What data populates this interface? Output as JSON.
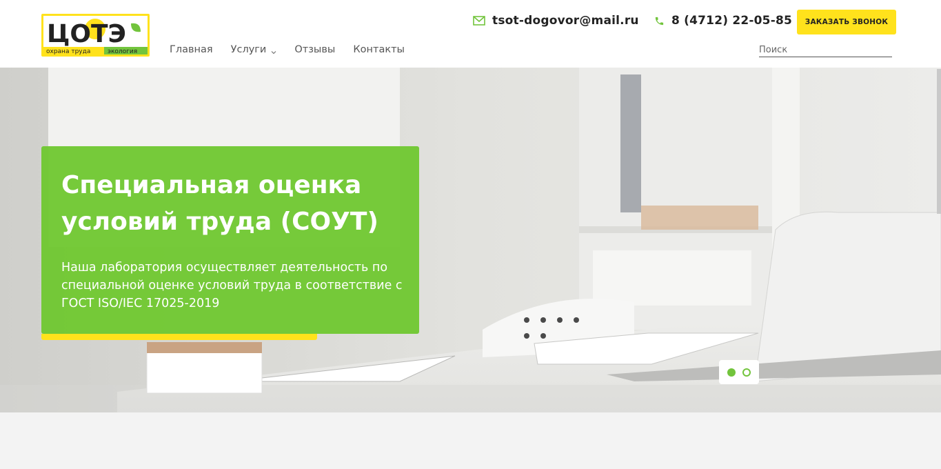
{
  "brand": {
    "logo_main": "ЦОТЭ",
    "logo_tag_left": "охрана труда",
    "logo_tag_right": "экология",
    "colors": {
      "accent_yellow": "#ffe21c",
      "accent_green": "#72c43c",
      "dark": "#222222"
    }
  },
  "nav": {
    "items": [
      {
        "label": "Главная"
      },
      {
        "label": "Услуги",
        "has_dropdown": true
      },
      {
        "label": "Отзывы"
      },
      {
        "label": "Контакты"
      }
    ]
  },
  "contacts": {
    "email": "tsot-dogovor@mail.ru",
    "email_icon": "envelope-icon",
    "phone": "8 (4712) 22-05-85",
    "phone_icon": "phone-icon"
  },
  "callback_button": {
    "label": "Заказать звонок"
  },
  "search": {
    "placeholder": "Поиск",
    "value": ""
  },
  "hero": {
    "title": "Специальная оценка условий труда (СОУТ)",
    "text": "Наша лаборатория осуществляет деятельность по специальной оценке условий труда в соответствие с ГОСТ ISO/IEC 17025-2019",
    "slides_total": 2,
    "active_slide": 1
  }
}
